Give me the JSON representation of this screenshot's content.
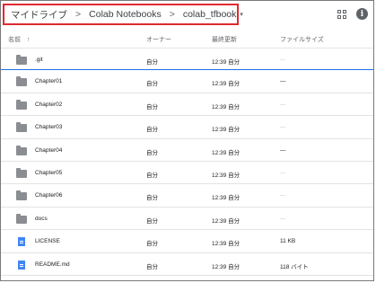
{
  "breadcrumb": {
    "items": [
      "マイドライブ",
      "Colab Notebooks",
      "colab_tfbook"
    ],
    "separator": ">",
    "dropdown_glyph": "▾"
  },
  "toolbar": {
    "grid_icon": "grid-view-icon",
    "info_icon": "info-icon",
    "info_glyph": "i"
  },
  "columns": {
    "name": "名前",
    "sort_arrow": "↑",
    "owner": "オーナー",
    "modified": "最終更新",
    "size": "ファイルサイズ"
  },
  "files": [
    {
      "name": ".git",
      "owner": "自分",
      "modified": "12:39 自分",
      "size": "—",
      "type": "folder"
    },
    {
      "name": "Chapter01",
      "owner": "自分",
      "modified": "12:39 自分",
      "size": "—",
      "type": "folder"
    },
    {
      "name": "Chapter02",
      "owner": "自分",
      "modified": "12:39 自分",
      "size": "—",
      "type": "folder"
    },
    {
      "name": "Chapter03",
      "owner": "自分",
      "modified": "12:39 自分",
      "size": "—",
      "type": "folder"
    },
    {
      "name": "Chapter04",
      "owner": "自分",
      "modified": "12:39 自分",
      "size": "—",
      "type": "folder"
    },
    {
      "name": "Chapter05",
      "owner": "自分",
      "modified": "12:39 自分",
      "size": "—",
      "type": "folder"
    },
    {
      "name": "Chapter06",
      "owner": "自分",
      "modified": "12:39 自分",
      "size": "—",
      "type": "folder"
    },
    {
      "name": "docs",
      "owner": "自分",
      "modified": "12:39 自分",
      "size": "—",
      "type": "folder"
    },
    {
      "name": "LICENSE",
      "owner": "自分",
      "modified": "12:39 自分",
      "size": "11 KB",
      "type": "file"
    },
    {
      "name": "README.md",
      "owner": "自分",
      "modified": "12:39 自分",
      "size": "118 バイト",
      "type": "file"
    }
  ],
  "colors": {
    "highlight_border": "#e02a31",
    "selection_line": "#1a73e8",
    "folder": "#8a8d91",
    "file": "#4285f4"
  }
}
